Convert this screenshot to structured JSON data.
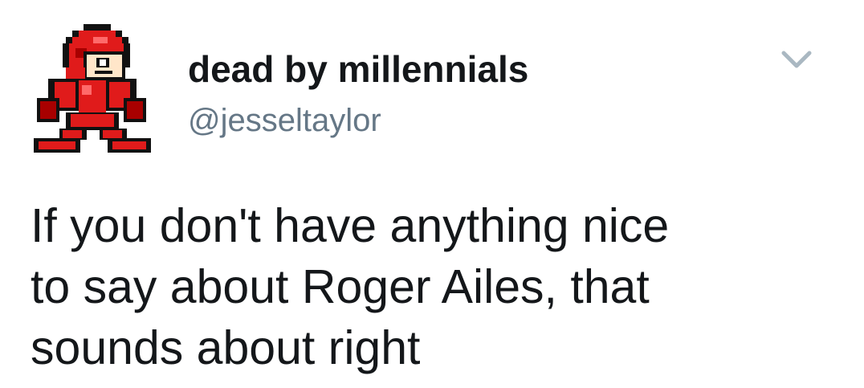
{
  "tweet": {
    "author": {
      "display_name": "dead by millennials",
      "handle": "@jesseltaylor",
      "avatar_icon": "pixel-robot-avatar-icon"
    },
    "menu_icon": "chevron-down-icon",
    "text": "If you don't have anything nice\nto say about Roger Ailes, that\nsounds about right"
  },
  "colors": {
    "name": "#14171a",
    "handle": "#657786",
    "chevron": "#aab8c2",
    "avatar_red": "#e01b1b",
    "avatar_dark_red": "#a80000",
    "avatar_skin": "#ffe6c9"
  }
}
